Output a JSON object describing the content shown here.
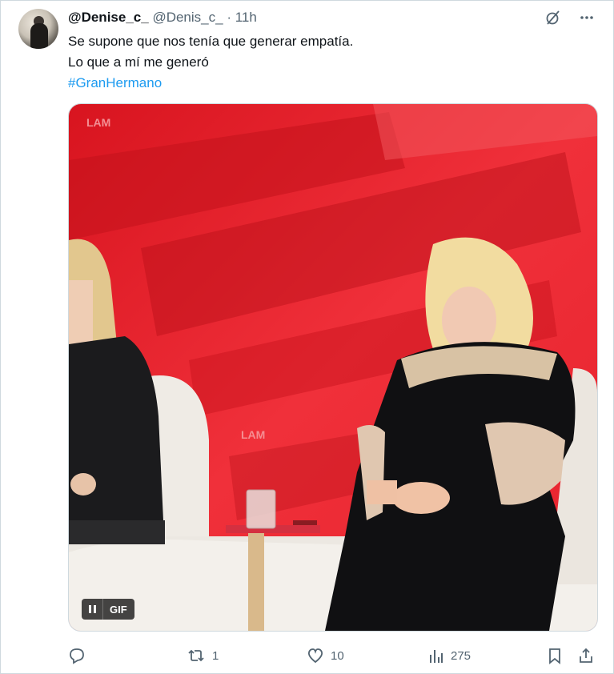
{
  "tweet": {
    "author_name": "@Denise_c_",
    "author_handle": "@Denis_c_",
    "separator": "·",
    "time": "11h",
    "text_line1": "Se supone que nos tenía que generar empatía.",
    "text_line2": "Lo que a mí me generó",
    "hashtag": "#GranHermano"
  },
  "media": {
    "type": "GIF",
    "badge_label": "GIF",
    "watermark_top": "LAM",
    "watermark_mid": "LAM"
  },
  "actions": {
    "replies": "",
    "retweets": "1",
    "likes": "10",
    "views": "275"
  },
  "colors": {
    "text": "#0f1419",
    "secondary": "#536471",
    "link": "#1d9bf0",
    "border": "#cfd9de",
    "studio_red": "#e01e2e"
  }
}
